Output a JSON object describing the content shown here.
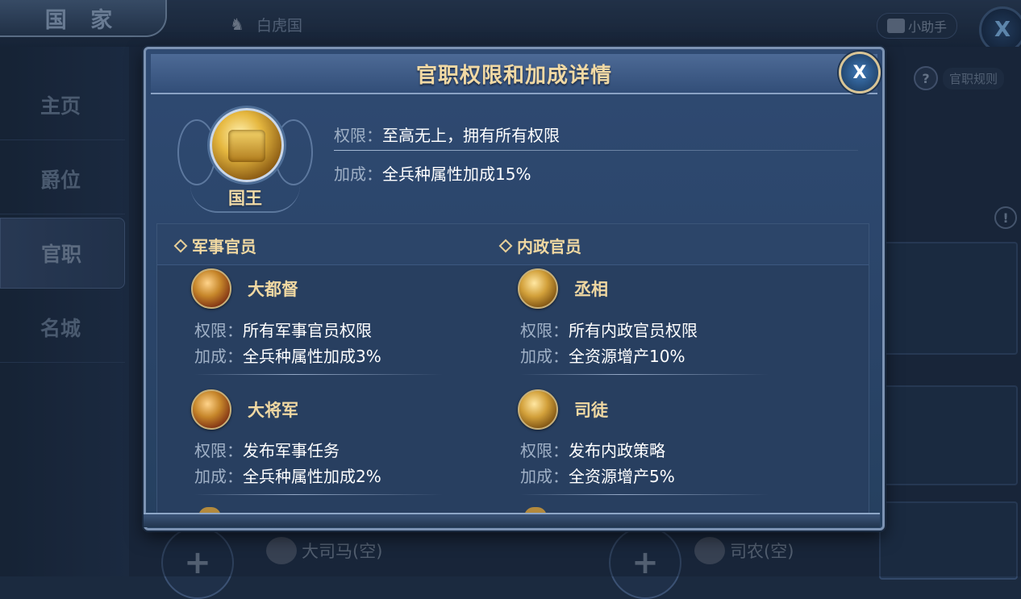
{
  "background": {
    "country_tab": "国 家",
    "nation_name": "白虎国",
    "helper_button": "小助手",
    "close_button": "X",
    "rules_button": "官职规则",
    "sidebar": [
      "主页",
      "爵位",
      "官职",
      "名城"
    ],
    "active_sidebar": "官职",
    "slots": [
      {
        "plus": "+",
        "name": "大司马(空)"
      },
      {
        "plus": "+",
        "name": "司农(空)"
      }
    ]
  },
  "modal": {
    "title": "官职权限和加成详情",
    "close_label": "X",
    "king": {
      "name": "国王",
      "permission_key": "权限：",
      "permission_value": "至高无上，拥有所有权限",
      "bonus_key": "加成：",
      "bonus_value": "全兵种属性加成15%"
    },
    "military": {
      "header": "军事官员",
      "ranks": [
        {
          "name": "大都督",
          "permission_key": "权限：",
          "permission": "所有军事官员权限",
          "bonus_key": "加成：",
          "bonus": "全兵种属性加成3%"
        },
        {
          "name": "大将军",
          "permission_key": "权限：",
          "permission": "发布军事任务",
          "bonus_key": "加成：",
          "bonus": "全兵种属性加成2%"
        }
      ]
    },
    "civil": {
      "header": "内政官员",
      "ranks": [
        {
          "name": "丞相",
          "permission_key": "权限：",
          "permission": "所有内政官员权限",
          "bonus_key": "加成：",
          "bonus": "全资源增产10%"
        },
        {
          "name": "司徒",
          "permission_key": "权限：",
          "permission": "发布内政策略",
          "bonus_key": "加成：",
          "bonus": "全资源增产5%"
        }
      ]
    }
  }
}
